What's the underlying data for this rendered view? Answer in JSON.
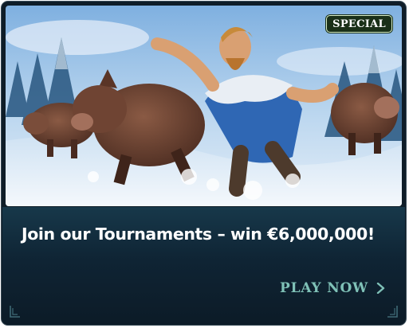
{
  "badge": {
    "label": "SPECIAL"
  },
  "promo": {
    "headline": "Join our Tournaments – win €6,000,000!",
    "cta_label": "PLAY NOW"
  },
  "colors": {
    "card_bg": "#0f1d28",
    "cta": "#7fc1b7",
    "badge_bg": "#1a3018"
  },
  "icons": {
    "cta": "chevron-right-icon",
    "corners": "corner-ornament-icon"
  }
}
